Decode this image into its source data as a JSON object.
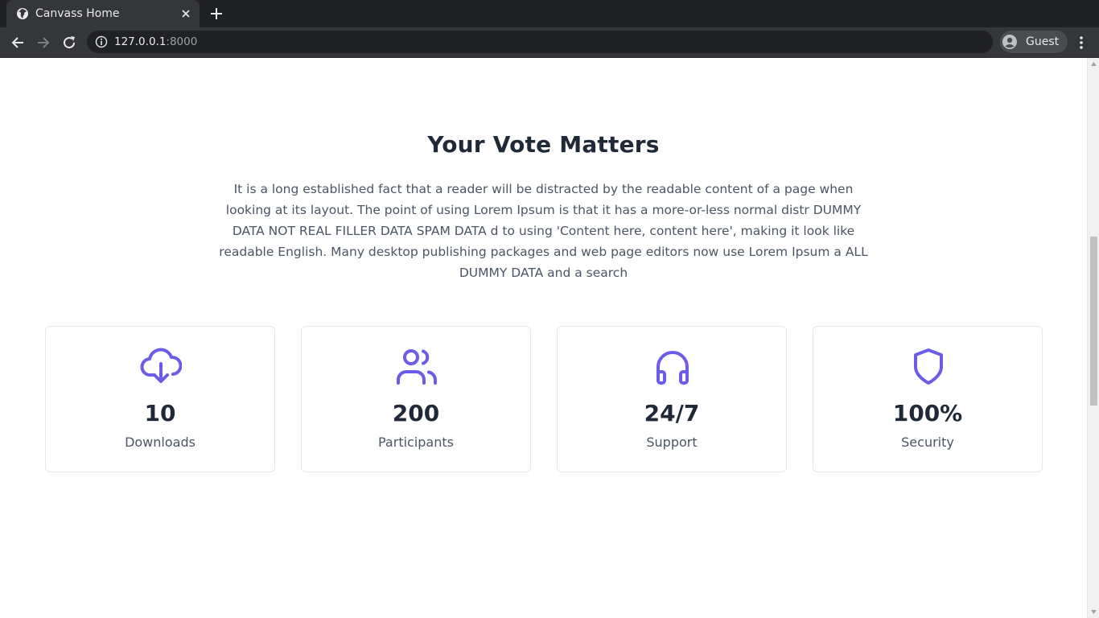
{
  "browser": {
    "tab_title": "Canvass Home",
    "url_host": "127.0.0.1",
    "url_port": ":8000",
    "profile_label": "Guest",
    "colors": {
      "chrome_dark": "#202124",
      "chrome_tab": "#35363a"
    }
  },
  "page": {
    "heading": "Your Vote Matters",
    "intro": "It is a long established fact that a reader will be distracted by the readable content of a page when looking at its layout. The point of using Lorem Ipsum is that it has a more-or-less normal distr DUMMY DATA NOT REAL FILLER DATA SPAM DATA d to using 'Content here, content here', making it look like readable English. Many desktop publishing packages and web page editors now use Lorem Ipsum a ALL DUMMY DATA and a search",
    "accent_color": "#6d5ce8",
    "stats": [
      {
        "icon": "cloud-download-icon",
        "value": "10",
        "label": "Downloads"
      },
      {
        "icon": "users-icon",
        "value": "200",
        "label": "Participants"
      },
      {
        "icon": "headphones-icon",
        "value": "24/7",
        "label": "Support"
      },
      {
        "icon": "shield-icon",
        "value": "100%",
        "label": "Security"
      }
    ]
  }
}
